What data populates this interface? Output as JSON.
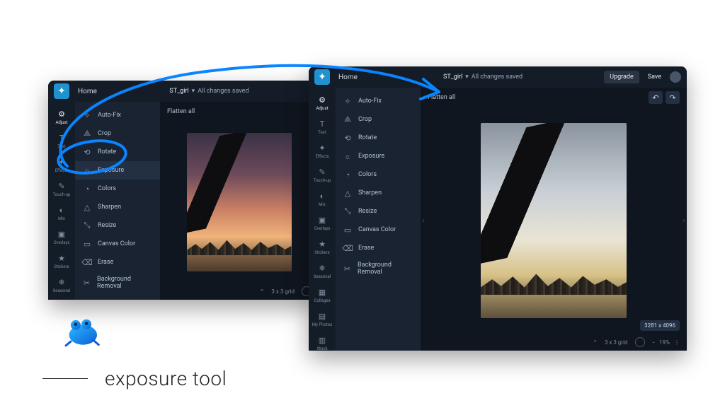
{
  "topbar": {
    "home": "Home",
    "filename": "ST_girl",
    "saved_status": "All changes saved",
    "upgrade": "Upgrade",
    "save": "Save"
  },
  "rail": [
    {
      "icon": "⚙",
      "label": "Adjust",
      "active": true
    },
    {
      "icon": "T",
      "label": "Text"
    },
    {
      "icon": "✦",
      "label": "Effects"
    },
    {
      "icon": "✎",
      "label": "Touch-up"
    },
    {
      "icon": "◐",
      "label": "Mix"
    },
    {
      "icon": "▣",
      "label": "Overlays"
    },
    {
      "icon": "★",
      "label": "Stickers"
    },
    {
      "icon": "❄",
      "label": "Seasonal"
    },
    {
      "icon": "▦",
      "label": "Collages"
    },
    {
      "icon": "▤",
      "label": "My Photos"
    },
    {
      "icon": "▥",
      "label": "Stock"
    }
  ],
  "tools": [
    {
      "icon": "✧",
      "label": "Auto-Fix"
    },
    {
      "icon": "⟁",
      "label": "Crop"
    },
    {
      "icon": "⟲",
      "label": "Rotate"
    },
    {
      "icon": "☼",
      "label": "Exposure"
    },
    {
      "icon": "◔",
      "label": "Colors"
    },
    {
      "icon": "△",
      "label": "Sharpen"
    },
    {
      "icon": "⤡",
      "label": "Resize"
    },
    {
      "icon": "▭",
      "label": "Canvas Color"
    },
    {
      "icon": "⌫",
      "label": "Erase"
    },
    {
      "icon": "✂",
      "label": "Background Removal"
    }
  ],
  "canvas": {
    "flatten": "Flatten all",
    "grid_label": "3 x 3 grid",
    "zoom": "19%",
    "dimensions": "3281 x 4096"
  },
  "annotation": {
    "caption": "exposure tool"
  },
  "highlight_tool_index_back": 3
}
